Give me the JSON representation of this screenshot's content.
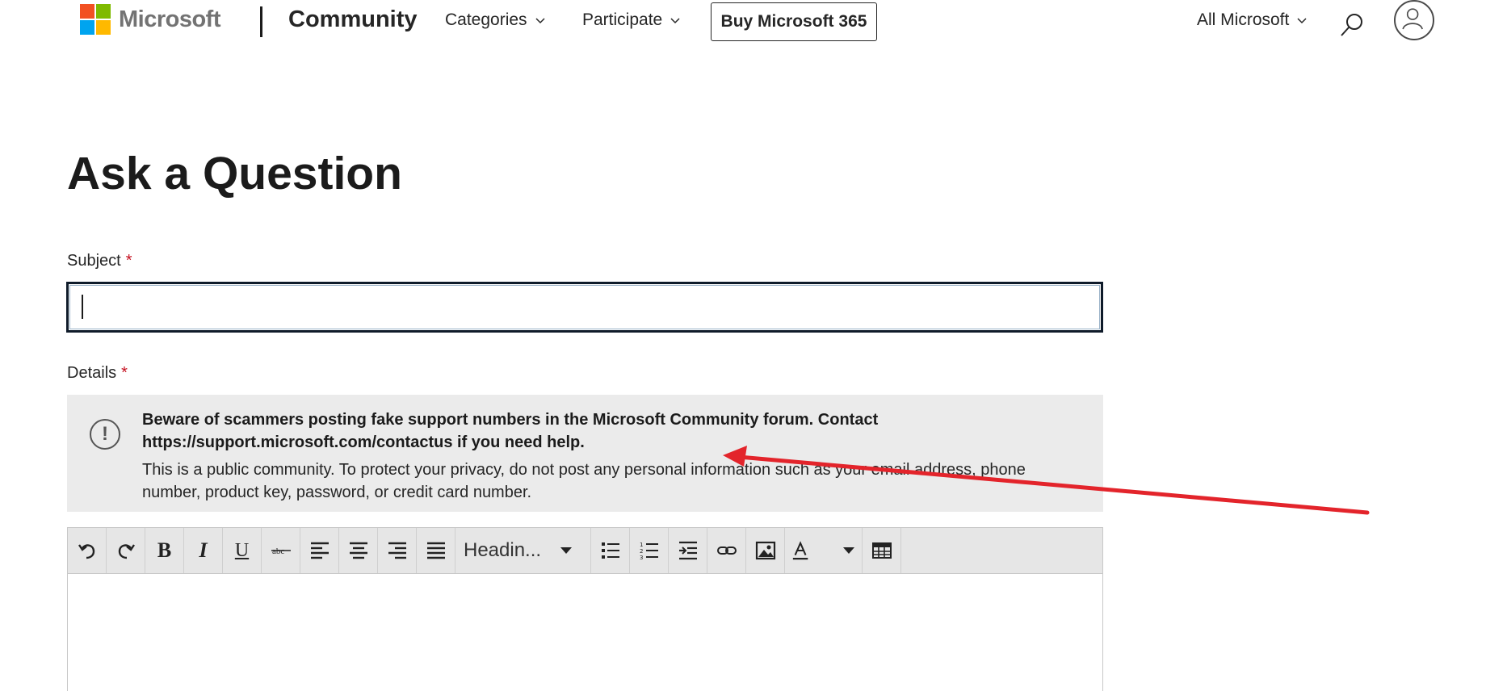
{
  "header": {
    "brand": "Microsoft",
    "site": "Community",
    "nav": [
      {
        "label": "Categories"
      },
      {
        "label": "Participate"
      }
    ],
    "buy_button": "Buy Microsoft 365",
    "all_microsoft": "All Microsoft",
    "logo_colors": [
      "#f25022",
      "#7fba00",
      "#00a4ef",
      "#ffb900"
    ]
  },
  "main": {
    "title": "Ask a Question",
    "subject": {
      "label": "Subject",
      "required_mark": "*",
      "value": ""
    },
    "details": {
      "label": "Details",
      "required_mark": "*"
    },
    "notice": {
      "icon": "exclamation-circle-icon",
      "bold_line1": "Beware of scammers posting fake support numbers in the Microsoft Community forum. Contact",
      "bold_line2": "https://support.microsoft.com/contactus if you need help.",
      "body": "This is a public community. To protect your privacy, do not post any personal information such as your email address, phone number, product key, password, or credit card number."
    },
    "editor": {
      "toolbar": {
        "bold": "B",
        "italic": "I",
        "underline": "U",
        "heading": "Headin...",
        "color_letter": "A"
      },
      "content": ""
    }
  },
  "colors": {
    "annotation_arrow": "#e3242b",
    "required": "#c50f1f"
  }
}
